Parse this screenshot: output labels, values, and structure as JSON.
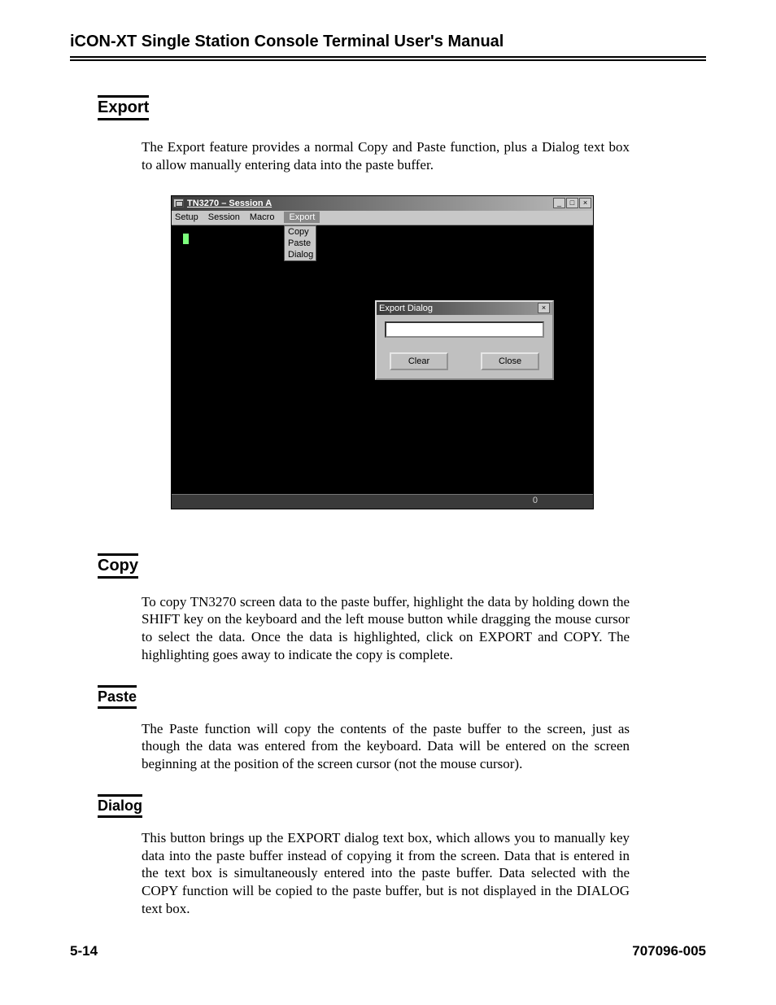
{
  "header": {
    "title": "iCON-XT Single Station Console Terminal User's Manual"
  },
  "sections": {
    "export": {
      "heading": "Export",
      "para": "The Export feature provides a normal Copy and Paste function, plus a Dialog text box to allow manually entering data into the paste buffer."
    },
    "copy": {
      "heading": "Copy",
      "para": "To copy TN3270 screen data to the paste buffer, highlight the data by holding down the SHIFT key on the keyboard and the left mouse button while dragging the mouse cursor to select the data. Once the data is highlighted, click on EXPORT and COPY. The highlighting goes away to indicate the copy is complete."
    },
    "paste": {
      "heading": "Paste",
      "para": "The Paste function will copy the contents of the paste buffer to the screen, just as though the data was entered from the keyboard. Data will be entered on the screen beginning at the position of the screen cursor (not the mouse cursor)."
    },
    "dialog": {
      "heading": "Dialog",
      "para": "This button brings up the EXPORT dialog text box, which allows you to manually key data into the paste buffer instead of copying it from the screen. Data that is entered in the text box is simultaneously entered into the paste buffer. Data selected with the COPY function will be copied to the paste buffer, but is not displayed in the DIALOG text box."
    }
  },
  "window": {
    "title": "TN3270 – Session A",
    "menus": {
      "setup": "Setup",
      "session": "Session",
      "macro": "Macro",
      "export": "Export"
    },
    "export_menu": {
      "copy": "Copy",
      "paste": "Paste",
      "dialog": "Dialog"
    },
    "dialog": {
      "title": "Export Dialog",
      "input": "",
      "clear": "Clear",
      "close": "Close"
    },
    "controls": {
      "min": "_",
      "max": "□",
      "close": "×"
    },
    "status_zero": "0"
  },
  "footer": {
    "page": "5-14",
    "doc": "707096-005"
  }
}
